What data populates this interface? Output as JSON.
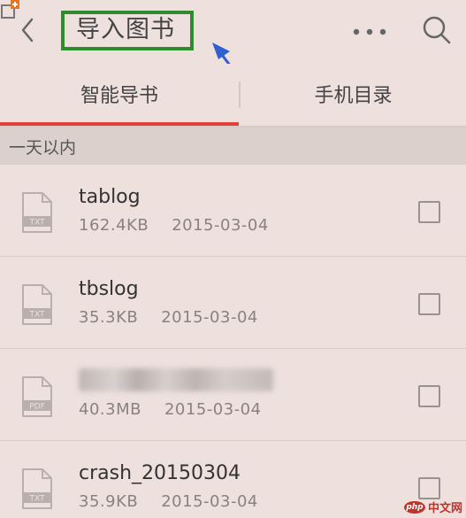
{
  "header": {
    "title": "导入图书"
  },
  "tabs": [
    {
      "label": "智能导书",
      "active": true
    },
    {
      "label": "手机目录",
      "active": false
    }
  ],
  "section": {
    "label": "一天以内"
  },
  "files": [
    {
      "type": "TXT",
      "name": "tablog",
      "size": "162.4KB",
      "date": "2015-03-04",
      "checked": false,
      "blurred": false
    },
    {
      "type": "TXT",
      "name": "tbslog",
      "size": "35.3KB",
      "date": "2015-03-04",
      "checked": false,
      "blurred": false
    },
    {
      "type": "PDF",
      "name": "",
      "size": "40.3MB",
      "date": "2015-03-04",
      "checked": false,
      "blurred": true
    },
    {
      "type": "TXT",
      "name": "crash_20150304",
      "size": "35.9KB",
      "date": "2015-03-04",
      "checked": false,
      "blurred": false
    }
  ],
  "watermark": {
    "badge": "php",
    "text": "中文网"
  },
  "colors": {
    "background": "#ede0dd",
    "accent": "#e0423a",
    "annotation_box": "#2e8b2e",
    "annotation_arrow": "#2f5fd0"
  },
  "icons": {
    "back": "chevron-left-icon",
    "more": "more-dots-icon",
    "search": "search-icon",
    "file": "document-icon"
  }
}
